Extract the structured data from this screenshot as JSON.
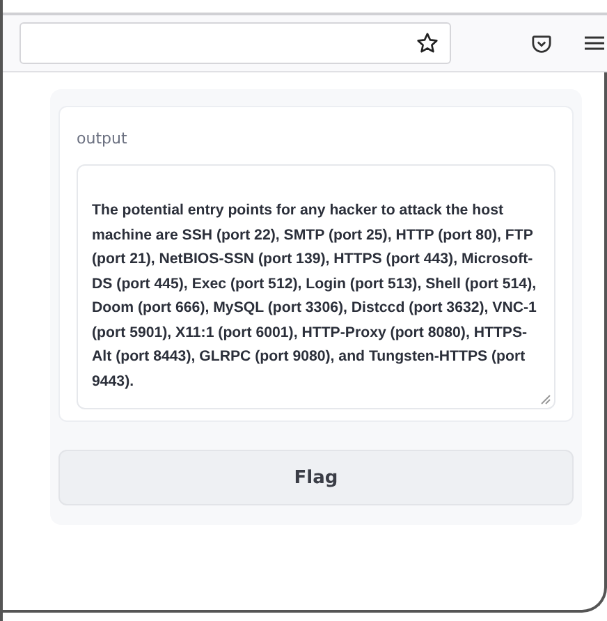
{
  "output": {
    "label": "output",
    "value": "The potential entry points for any hacker to attack the host machine are SSH (port 22), SMTP (port 25), HTTP (port 80), FTP (port 21), NetBIOS-SSN (port 139), HTTPS (port 443), Microsoft-DS (port 445), Exec (port 512), Login (port 513), Shell (port 514), Doom (port 666), MySQL (port 3306), Distccd (port 3632), VNC-1 (port 5901), X11:1 (port 6001), HTTP-Proxy (port 8080), HTTPS-Alt (port 8443), GLRPC (port 9080), and Tungsten-HTTPS (port 9443)."
  },
  "buttons": [
    {
      "label": "Flag"
    }
  ]
}
